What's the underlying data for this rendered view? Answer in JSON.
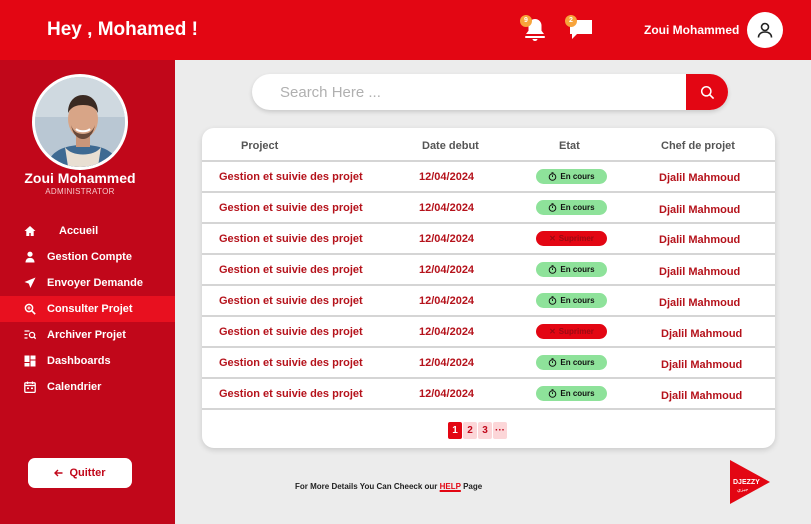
{
  "header": {
    "greeting": "Hey , Mohamed !",
    "notifications_count": "9",
    "messages_count": "2",
    "user_name": "Zoui Mohammed"
  },
  "sidebar": {
    "name": "Zoui Mohammed",
    "role": "ADMINISTRATOR",
    "items": [
      {
        "label": "Accueil",
        "icon": "home-icon"
      },
      {
        "label": "Gestion Compte",
        "icon": "user-icon"
      },
      {
        "label": "Envoyer Demande",
        "icon": "send-icon"
      },
      {
        "label": "Consulter Projet",
        "icon": "search-doc-icon"
      },
      {
        "label": "Archiver Projet",
        "icon": "archive-list-icon"
      },
      {
        "label": "Dashboards",
        "icon": "dashboard-icon"
      },
      {
        "label": "Calendrier",
        "icon": "calendar-icon"
      }
    ],
    "active_item": "Consulter Projet",
    "quit_label": "Quitter"
  },
  "search": {
    "placeholder": "Search Here ..."
  },
  "table": {
    "headers": {
      "project": "Project",
      "date": "Date debut",
      "status": "Etat",
      "chef": "Chef de projet"
    },
    "rows": [
      {
        "project": "Gestion et suivie des projet",
        "date": "12/04/2024",
        "status": "En cours",
        "chef": "Djalil Mahmoud"
      },
      {
        "project": "Gestion et suivie des projet",
        "date": "12/04/2024",
        "status": "En cours",
        "chef": "Djalil Mahmoud"
      },
      {
        "project": "Gestion et suivie des projet",
        "date": "12/04/2024",
        "status": "Suprimer",
        "chef": "Djalil Mahmoud"
      },
      {
        "project": "Gestion et suivie des projet",
        "date": "12/04/2024",
        "status": "En cours",
        "chef": "Djalil Mahmoud"
      },
      {
        "project": "Gestion et suivie des projet",
        "date": "12/04/2024",
        "status": "En cours",
        "chef": "Djalil Mahmoud"
      },
      {
        "project": "Gestion et suivie des projet",
        "date": "12/04/2024",
        "status": "Suprimer",
        "chef": "Djalil Mahmoud"
      },
      {
        "project": "Gestion et suivie des projet",
        "date": "12/04/2024",
        "status": "En cours",
        "chef": "Djalil Mahmoud"
      },
      {
        "project": "Gestion et suivie des projet",
        "date": "12/04/2024",
        "status": "En cours",
        "chef": "Djalil Mahmoud"
      }
    ]
  },
  "pagination": {
    "pages": [
      "1",
      "2",
      "3",
      "···"
    ],
    "current": "1"
  },
  "footer": {
    "text_before": "For More Details You Can Cheeck our",
    "help": "HELP",
    "text_after": "Page"
  },
  "logo": {
    "text": "DJEZZY",
    "subtext": "جيزي"
  },
  "colors": {
    "brand_red": "#e30613",
    "sidebar_red": "#c1071a",
    "status_ok": "#8ee29a",
    "status_deleted": "#e30613"
  }
}
